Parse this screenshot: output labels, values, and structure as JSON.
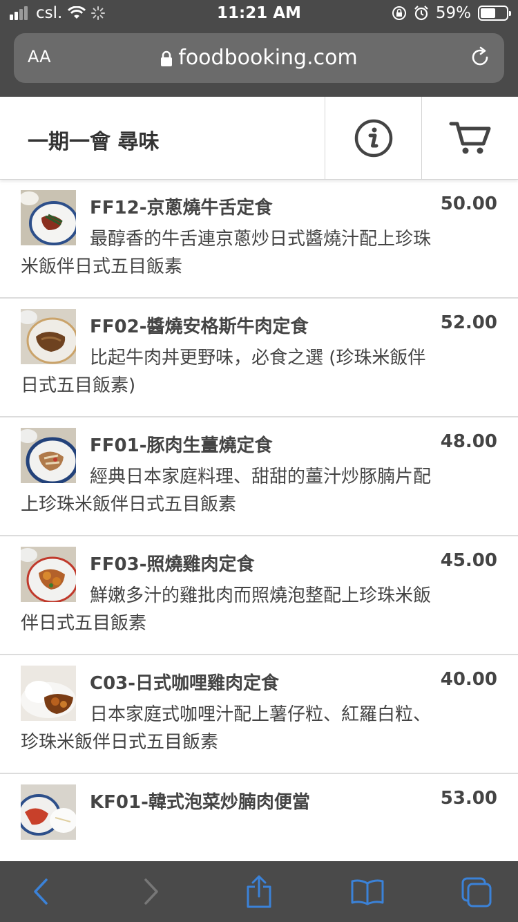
{
  "status_bar": {
    "carrier": "csl.",
    "time": "11:21 AM",
    "battery_text": "59%",
    "battery_level": 0.59
  },
  "browser": {
    "text_size_label": "AA",
    "url": "foodbooking.com"
  },
  "header": {
    "shop_name": "一期一會 尋味"
  },
  "menu": [
    {
      "name": "FF12-京蔥燒牛舌定食",
      "price": "50.00",
      "description": "最醇香的牛舌連京蔥炒日式醬燒汁配上珍珠米飯伴日式五目飯素"
    },
    {
      "name": "FF02-醬燒安格斯牛肉定食",
      "price": "52.00",
      "description": "比起牛肉丼更野味，必食之選 (珍珠米飯伴日式五目飯素)"
    },
    {
      "name": "FF01-豚肉生薑燒定食",
      "price": "48.00",
      "description": "經典日本家庭料理、甜甜的薑汁炒豚腩片配上珍珠米飯伴日式五目飯素"
    },
    {
      "name": "FF03-照燒雞肉定食",
      "price": "45.00",
      "description": "鮮嫩多汁的雞批肉而照燒泡整配上珍珠米飯伴日式五目飯素"
    },
    {
      "name": "C03-日式咖哩雞肉定食",
      "price": "40.00",
      "description": "日本家庭式咖哩汁配上薯仔粒、紅羅白粒、珍珠米飯伴日式五目飯素"
    },
    {
      "name": "KF01-韓式泡菜炒腩肉便當",
      "price": "53.00",
      "description": ""
    }
  ],
  "colors": {
    "chrome_bg": "#4a4a4a",
    "url_bar_bg": "#6b6b6b",
    "toolbar_icon_active": "#3b82d8",
    "toolbar_icon_disabled": "#777777"
  },
  "icons": {
    "info": "info-icon",
    "cart": "cart-icon",
    "back": "back-arrow-icon",
    "forward": "forward-arrow-icon",
    "share": "share-icon",
    "bookmarks": "bookmarks-icon",
    "tabs": "tabs-icon"
  }
}
